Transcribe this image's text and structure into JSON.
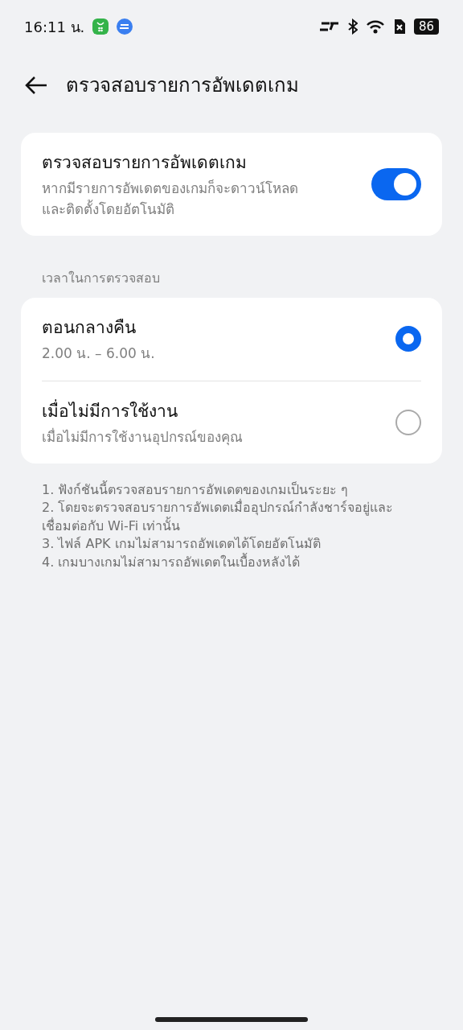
{
  "status_bar": {
    "time": "16:11 น.",
    "battery": "86"
  },
  "header": {
    "title": "ตรวจสอบรายการอัพเดตเกม"
  },
  "auto_update": {
    "title": "ตรวจสอบรายการอัพเดตเกม",
    "subtitle": "หากมีรายการอัพเดตของเกมก็จะดาวน์โหลดและติดตั้งโดยอัตโนมัติ",
    "on": true
  },
  "schedule": {
    "label": "เวลาในการตรวจสอบ",
    "options": [
      {
        "title": "ตอนกลางคืน",
        "subtitle": "2.00 น. – 6.00 น.",
        "selected": true
      },
      {
        "title": "เมื่อไม่มีการใช้งาน",
        "subtitle": "เมื่อไม่มีการใช้งานอุปกรณ์ของคุณ",
        "selected": false
      }
    ]
  },
  "notes": [
    "1. ฟังก์ชันนี้ตรวจสอบรายการอัพเดตของเกมเป็นระยะ ๆ",
    "2. โดยจะตรวจสอบรายการอัพเดตเมื่ออุปกรณ์กำลังชาร์จอยู่และเชื่อมต่อกับ Wi-Fi เท่านั้น",
    "3. ไฟล์ APK เกมไม่สามารถอัพเดตได้โดยอัตโนมัติ",
    "4. เกมบางเกมไม่สามารถอัพเดตในเบื้องหลังได้"
  ]
}
